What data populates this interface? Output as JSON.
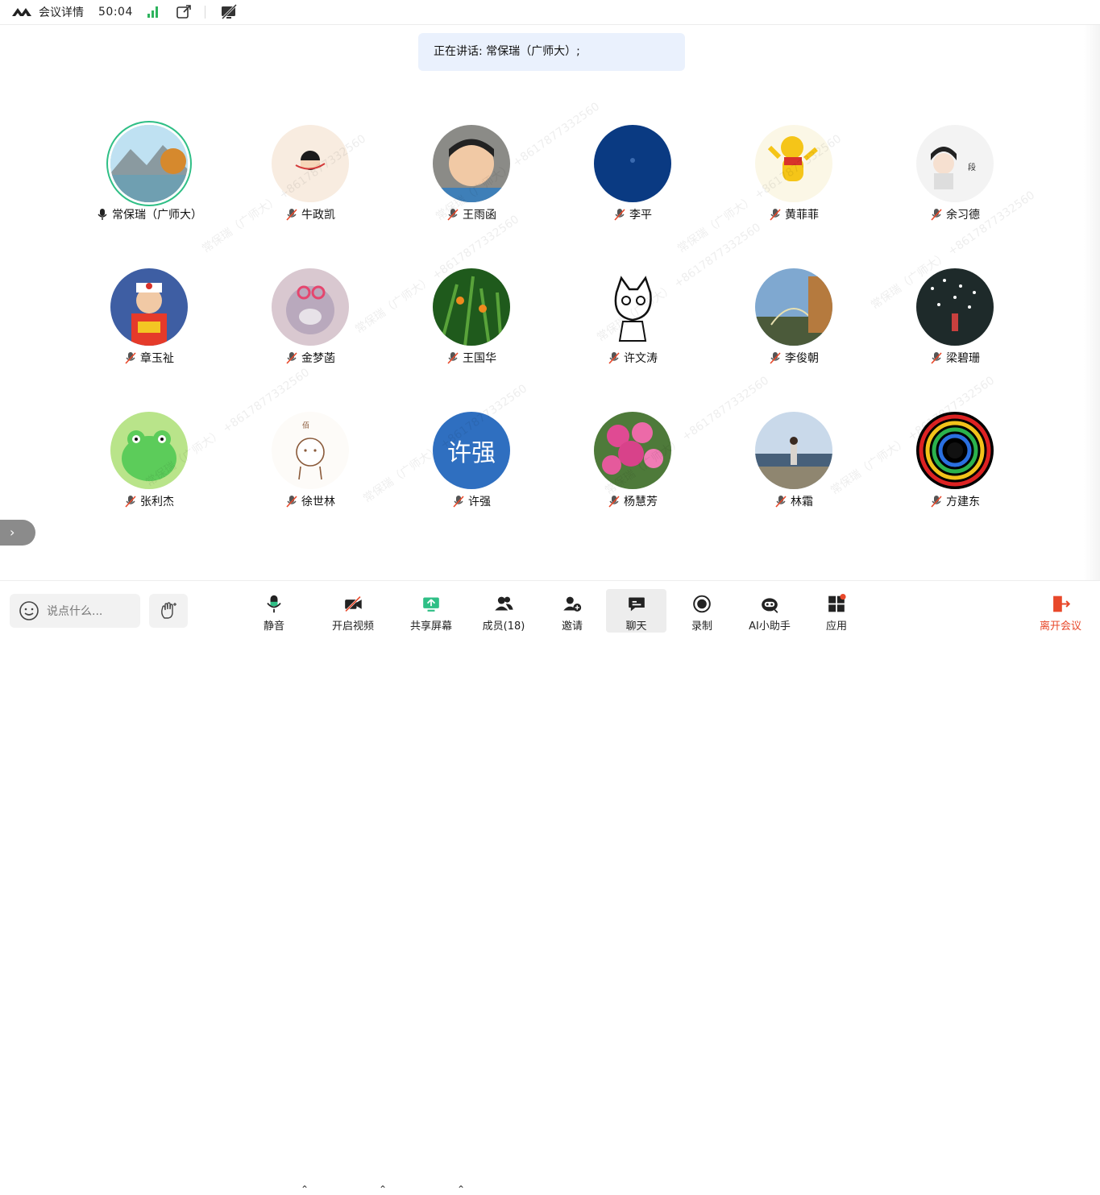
{
  "topbar": {
    "title": "会议详情",
    "timer": "50:04"
  },
  "speaking_banner": "正在讲话: 常保瑞（广师大）;",
  "watermark_text": "常保瑞（广师大） +8617877332560",
  "participants": [
    {
      "name": "常保瑞（广师大）",
      "muted": false,
      "speaking": true
    },
    {
      "name": "牛政凯",
      "muted": true
    },
    {
      "name": "王雨函",
      "muted": true
    },
    {
      "name": "李平",
      "muted": true
    },
    {
      "name": "黄菲菲",
      "muted": true
    },
    {
      "name": "余习德",
      "muted": true
    },
    {
      "name": "章玉祉",
      "muted": true
    },
    {
      "name": "金梦菡",
      "muted": true
    },
    {
      "name": "王国华",
      "muted": true
    },
    {
      "name": "许文涛",
      "muted": true
    },
    {
      "name": "李俊朝",
      "muted": true
    },
    {
      "name": "梁碧珊",
      "muted": true
    },
    {
      "name": "张利杰",
      "muted": true
    },
    {
      "name": "徐世林",
      "muted": true
    },
    {
      "name": "许强",
      "muted": true,
      "avatar_text": "许强"
    },
    {
      "name": "杨慧芳",
      "muted": true
    },
    {
      "name": "林霜",
      "muted": true
    },
    {
      "name": "方建东",
      "muted": true
    }
  ],
  "toolbar": {
    "chat_placeholder": "说点什么...",
    "mute": "静音",
    "video": "开启视频",
    "share": "共享屏幕",
    "members": "成员(18)",
    "invite": "邀请",
    "chat": "聊天",
    "record": "录制",
    "ai": "AI小助手",
    "apps": "应用",
    "leave": "离开会议"
  },
  "colors": {
    "accent": "#2fbf86",
    "signal": "#2db35d",
    "leave": "#e8482a",
    "banner_bg": "#eaf1fd"
  }
}
